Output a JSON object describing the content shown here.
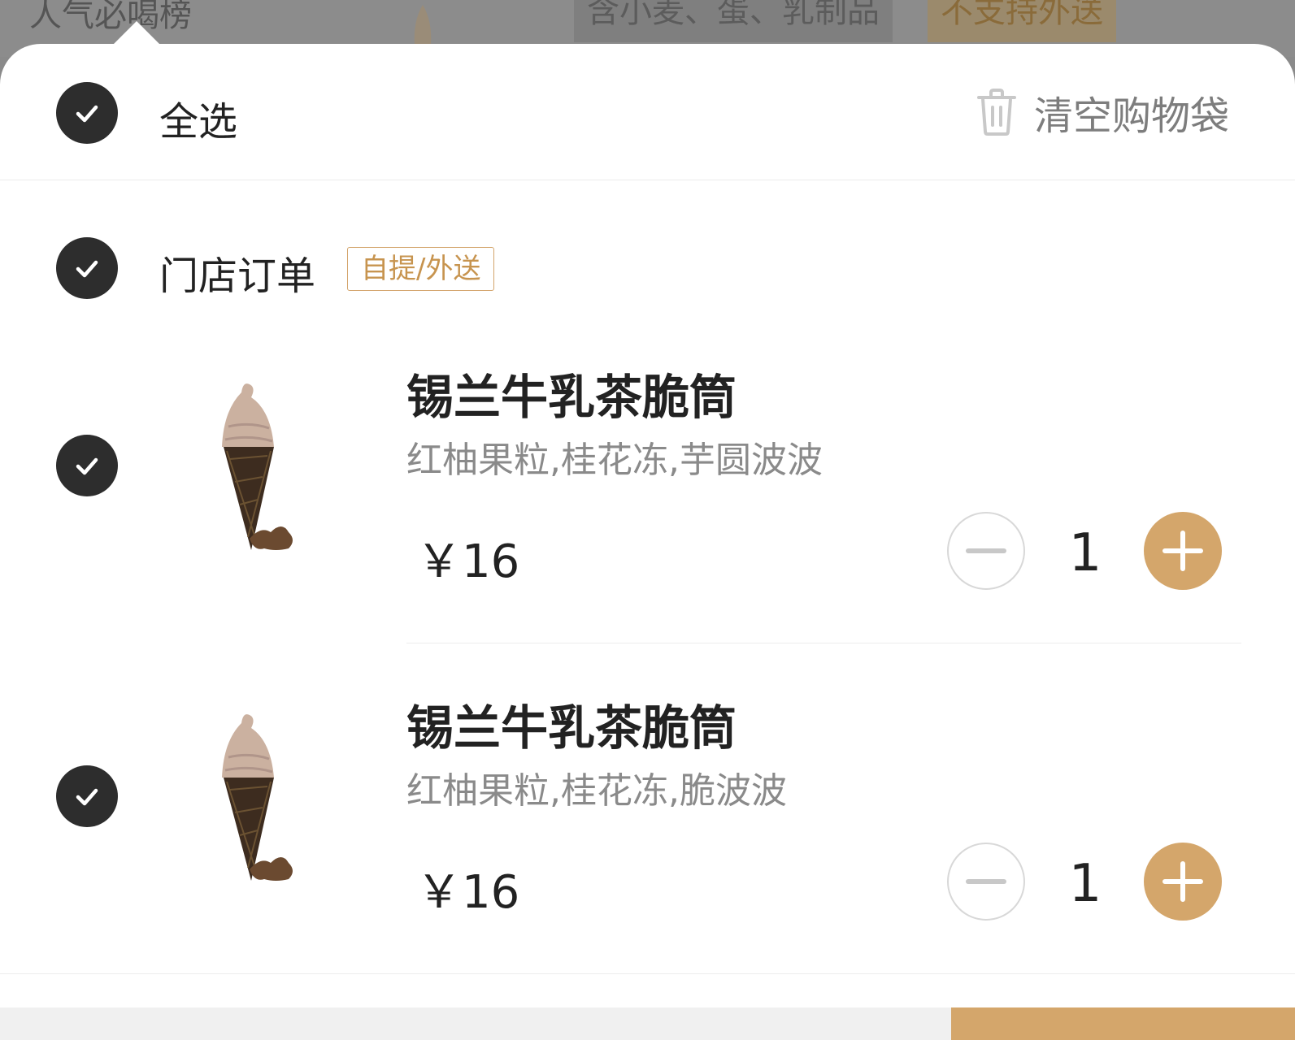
{
  "background": {
    "category_title": "人气必喝榜",
    "allergen_text": "含小麦、蛋、乳制品",
    "delivery_notice": "不支持外送"
  },
  "header": {
    "select_all_label": "全选",
    "clear_cart_label": "清空购物袋"
  },
  "store_group": {
    "label": "门店订单",
    "tag": "自提/外送"
  },
  "items": [
    {
      "name": "锡兰牛乳茶脆筒",
      "options": "红柚果粒,桂花冻,芋圆波波",
      "price": "￥16",
      "quantity": "1"
    },
    {
      "name": "锡兰牛乳茶脆筒",
      "options": "红柚果粒,桂花冻,脆波波",
      "price": "￥16",
      "quantity": "1"
    }
  ],
  "icons": {
    "check": "check-icon",
    "trash": "trash-icon",
    "minus": "minus-icon",
    "plus": "plus-icon",
    "product": "ice-cream-cone-image"
  },
  "colors": {
    "accent": "#d4a66b",
    "check_fill": "#2d2d2d",
    "tag_border": "#d3a46b"
  }
}
